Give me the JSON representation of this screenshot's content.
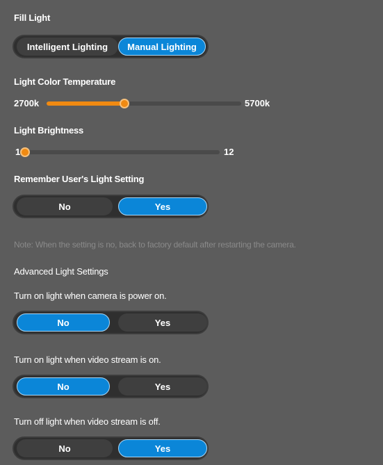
{
  "fill_light": {
    "title": "Fill Light",
    "mode_options": [
      "Intelligent Lighting",
      "Manual Lighting"
    ],
    "selected_mode": "Manual Lighting"
  },
  "color_temperature": {
    "label": "Light Color Temperature",
    "min_label": "2700k",
    "max_label": "5700k",
    "fraction": 0.4
  },
  "brightness": {
    "label": "Light Brightness",
    "min_label": "1",
    "max_label": "12",
    "value": 1
  },
  "remember": {
    "label": "Remember User's Light Setting",
    "options": [
      "No",
      "Yes"
    ],
    "selected": "Yes"
  },
  "note": "Note: When the setting is no, back to factory default after restarting the camera.",
  "advanced": {
    "title": "Advanced Light Settings",
    "power_on": {
      "label": "Turn on light when camera is power on.",
      "options": [
        "No",
        "Yes"
      ],
      "selected": "No"
    },
    "stream_on": {
      "label": "Turn on light when video stream is on.",
      "options": [
        "No",
        "Yes"
      ],
      "selected": "No"
    },
    "stream_off": {
      "label": "Turn off light when video stream is off.",
      "options": [
        "No",
        "Yes"
      ],
      "selected": "Yes"
    }
  },
  "colors": {
    "accent": "#0b86d8",
    "slider": "#f08a12",
    "background": "#5c5c5c"
  }
}
